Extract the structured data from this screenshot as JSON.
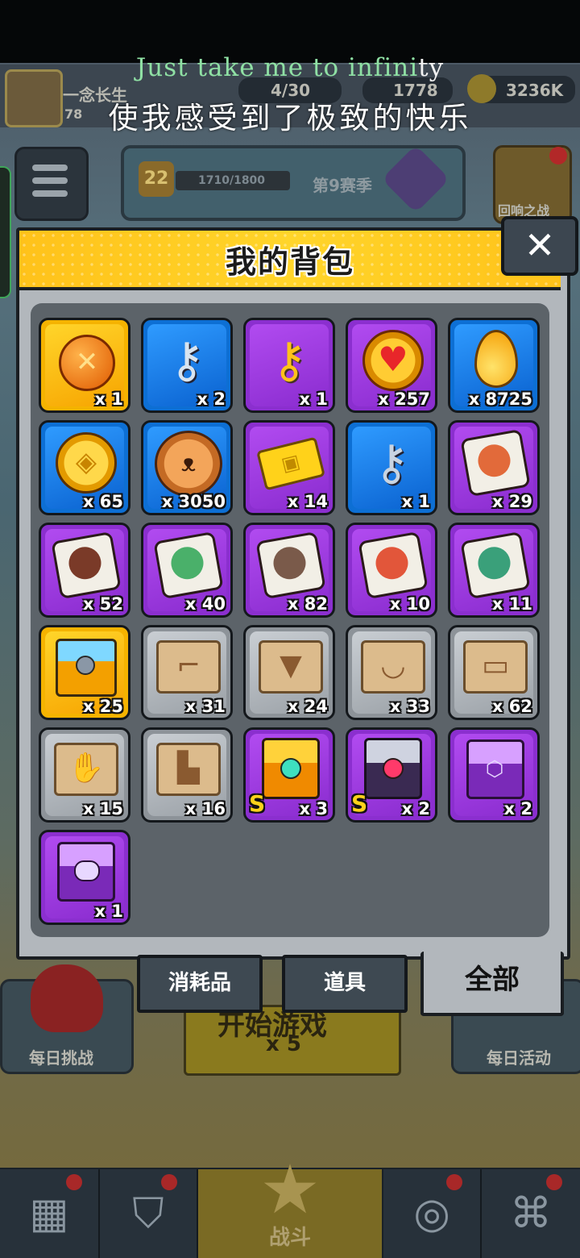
{
  "subtitles": {
    "line1_green": "Just take me to infini",
    "line1_white": "ty",
    "line2": "使我感受到了极致的快乐"
  },
  "background": {
    "player_name": "一念长生",
    "player_level": "78",
    "energy": "4/30",
    "gems": "1778",
    "gold": "3236K",
    "season_level": "22",
    "season_progress": "1710/1800",
    "season_name": "第9赛季",
    "echo_battle": "回响之战",
    "daily_challenge": "每日挑战",
    "start_game": "开始游戏",
    "start_cost": "x 5",
    "daily_event": "每日活动",
    "nav_battle": "战斗"
  },
  "inventory": {
    "title": "我的背包",
    "close_icon": "✕",
    "tabs": {
      "consumables": "消耗品",
      "props": "道具",
      "all": "全部"
    },
    "active_tab": "all",
    "items": [
      {
        "name": "orange-token",
        "rarity": "orange",
        "qty": "x 1"
      },
      {
        "name": "silver-key",
        "rarity": "blue",
        "qty": "x 2"
      },
      {
        "name": "gold-key",
        "rarity": "purple",
        "qty": "x 1"
      },
      {
        "name": "heart-coin",
        "rarity": "purple",
        "qty": "x 257"
      },
      {
        "name": "gold-drop",
        "rarity": "blue",
        "qty": "x 8725"
      },
      {
        "name": "gold-coin",
        "rarity": "blue",
        "qty": "x 65"
      },
      {
        "name": "bear-cookie",
        "rarity": "blue",
        "qty": "x 3050"
      },
      {
        "name": "gold-ticket",
        "rarity": "purple",
        "qty": "x 14"
      },
      {
        "name": "skull-key",
        "rarity": "blue",
        "qty": "x 1"
      },
      {
        "name": "puzzle-shard-1",
        "rarity": "purple",
        "qty": "x 29"
      },
      {
        "name": "puzzle-shard-2",
        "rarity": "purple",
        "qty": "x 52"
      },
      {
        "name": "puzzle-shard-3",
        "rarity": "purple",
        "qty": "x 40"
      },
      {
        "name": "puzzle-shard-4",
        "rarity": "purple",
        "qty": "x 82"
      },
      {
        "name": "puzzle-shard-5",
        "rarity": "purple",
        "qty": "x 10"
      },
      {
        "name": "puzzle-shard-6",
        "rarity": "purple",
        "qty": "x 11"
      },
      {
        "name": "orange-chest",
        "rarity": "orange",
        "qty": "x 25"
      },
      {
        "name": "weapon-blueprint",
        "rarity": "gray",
        "qty": "x 31"
      },
      {
        "name": "armor-blueprint",
        "rarity": "gray",
        "qty": "x 24"
      },
      {
        "name": "necklace-blueprint",
        "rarity": "gray",
        "qty": "x 33"
      },
      {
        "name": "belt-blueprint",
        "rarity": "gray",
        "qty": "x 62"
      },
      {
        "name": "glove-blueprint",
        "rarity": "gray",
        "qty": "x 15"
      },
      {
        "name": "boots-blueprint",
        "rarity": "gray",
        "qty": "x 16"
      },
      {
        "name": "s-chest-teal",
        "rarity": "purple",
        "qty": "x 3",
        "badge": "S"
      },
      {
        "name": "s-chest-dark",
        "rarity": "purple",
        "qty": "x 2",
        "badge": "S"
      },
      {
        "name": "purple-hex-chest",
        "rarity": "purple",
        "qty": "x 2"
      },
      {
        "name": "purple-eye-chest",
        "rarity": "purple",
        "qty": "x 1"
      }
    ]
  },
  "colors": {
    "header_yellow": "#ffc21a",
    "rarity_orange": "#f5b300",
    "rarity_blue": "#0d6fd4",
    "rarity_purple": "#8b2fcf",
    "rarity_gray": "#8d9399"
  }
}
